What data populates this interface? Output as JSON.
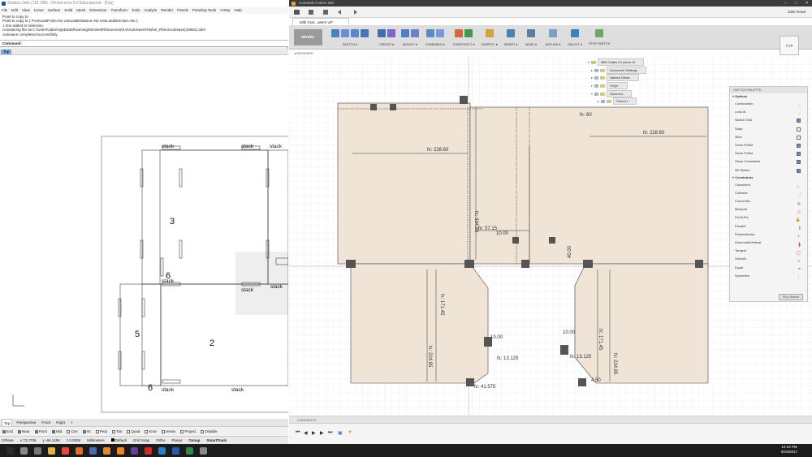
{
  "rhino": {
    "title": "Slotbox.3dm (191 MB) - Rhinoceros 5.0 Educational - [Top]",
    "menu": [
      "File",
      "Edit",
      "View",
      "Curve",
      "Surface",
      "Solid",
      "Mesh",
      "Dimension",
      "Transform",
      "Tools",
      "Analyze",
      "Render",
      "Panels",
      "Paneling Tools",
      "V-Ray",
      "Help"
    ],
    "command_history": [
      "Point to copy to",
      "Point to copy to ( FromLastPoint=No  UseLastDistance=No  UseLastDirection=No ):",
      "1 text added to selection.",
      "Autosaving file as C:\\Users\\Jake\\AppData\\Roaming\\McNeel\\Rhinoceros\\5.0\\AutoSave\\rhtshot_RhinoAutosave(15664).3dm",
      "Autosave completed successfully"
    ],
    "command_label": "Command:",
    "viewport_label": "Top",
    "drawing": {
      "labels": [
        "stack",
        "stack",
        "stack",
        "stack",
        "stack",
        "stack",
        "stack",
        "stack"
      ],
      "numbers": [
        "3",
        "6",
        "5",
        "2",
        "6"
      ]
    },
    "viewport_tabs": [
      "Top",
      "Perspective",
      "Front",
      "Right",
      "+"
    ],
    "osnaps": [
      {
        "label": "End",
        "on": true
      },
      {
        "label": "Near",
        "on": true
      },
      {
        "label": "Point",
        "on": true
      },
      {
        "label": "Mid",
        "on": true
      },
      {
        "label": "Cen",
        "on": false
      },
      {
        "label": "Int",
        "on": true
      },
      {
        "label": "Perp",
        "on": false
      },
      {
        "label": "Tan",
        "on": false
      },
      {
        "label": "Quad",
        "on": false
      },
      {
        "label": "Knot",
        "on": false
      },
      {
        "label": "Vertex",
        "on": false
      },
      {
        "label": "Project",
        "on": false
      },
      {
        "label": "Disable",
        "on": false
      }
    ],
    "status": {
      "cplane": "CPlane",
      "x": "x 73.2706",
      "y": "y -66.1456",
      "z": "z 0.0000",
      "units": "Millimeters",
      "layer": "Default",
      "grid_snap": "Grid Snap",
      "ortho": "Ortho",
      "planar": "Planar",
      "osnap": "Osnap",
      "smarttrack": "SmartTrack"
    }
  },
  "fusion": {
    "title": "Autodesk Fusion 360",
    "user": "Jake Read",
    "doc_tab": "Milk Crat...asers v3*",
    "workspace": "MODEL",
    "ribbon_groups": [
      {
        "label": "SKETCH ▾",
        "colors": [
          "#4a7fc1",
          "#6b8fd6",
          "#5c87c9",
          "#4a74b8"
        ]
      },
      {
        "label": "CREATE ▾",
        "colors": [
          "#3d6fb5",
          "#7b68c8"
        ]
      },
      {
        "label": "MODIFY ▾",
        "colors": [
          "#4e7fc5",
          "#6f7fd0"
        ]
      },
      {
        "label": "ASSEMBLE ▾",
        "colors": [
          "#5b8ac9",
          "#7a9bd8"
        ]
      },
      {
        "label": "CONSTRUCT ▾",
        "colors": [
          "#d06a3a",
          "#3e9a4e"
        ]
      },
      {
        "label": "INSPECT ▾",
        "colors": [
          "#d0a33c"
        ]
      },
      {
        "label": "INSERT ▾",
        "colors": [
          "#4f7fb0"
        ]
      },
      {
        "label": "MAKE ▾",
        "colors": [
          "#5e7e9e"
        ]
      },
      {
        "label": "ADD-INS ▾",
        "colors": [
          "#7aa0c8"
        ]
      },
      {
        "label": "SELECT ▾",
        "colors": [
          "#3e7fc4"
        ]
      },
      {
        "label": "STOP SKETCH",
        "colors": [
          "#6aa86a"
        ]
      }
    ],
    "browser_label": "BROWSER",
    "tree": [
      "Milk Crates & Lasers v3",
      "Document Settings",
      "Named Views",
      "Origin",
      "Sketches",
      "Sketch1"
    ],
    "viewcube": "TOP",
    "dimensions": [
      "fx: 228.60",
      "fx: 228.60",
      "fx: 60",
      "fx: 334.80",
      "fx: 57.15",
      "10.00",
      "40.00",
      "fx: 171.45",
      "fx: 171.45",
      "fx: 224.85",
      "fx: 224.85",
      "10.00",
      "10.00",
      "fx: 13.125",
      "fx: 13.125",
      "fx: 41.575",
      "4.50"
    ],
    "sketch_palette": {
      "title": "SKETCH PALETTE",
      "options_label": "Options",
      "options": [
        {
          "label": "Construction",
          "kind": "icon"
        },
        {
          "label": "Look At",
          "kind": "icon"
        },
        {
          "label": "Sketch Grid",
          "kind": "check",
          "on": true
        },
        {
          "label": "Snap",
          "kind": "check",
          "on": false
        },
        {
          "label": "Slice",
          "kind": "check",
          "on": false
        },
        {
          "label": "Show Profile",
          "kind": "check",
          "on": true
        },
        {
          "label": "Show Points",
          "kind": "check",
          "on": true
        },
        {
          "label": "Show Constraints",
          "kind": "check",
          "on": true
        },
        {
          "label": "3D Sketch",
          "kind": "check",
          "on": true
        }
      ],
      "constraints_label": "Constraints",
      "constraints": [
        "Coincident",
        "Collinear",
        "Concentric",
        "Midpoint",
        "Fix/UnFix",
        "Parallel",
        "Perpendicular",
        "Horizontal/Vertical",
        "Tangent",
        "Smooth",
        "Equal",
        "Symmetry"
      ],
      "stop_button": "Stop Sketch"
    },
    "comments_label": "COMMENTS"
  },
  "taskbar": {
    "icons": [
      {
        "name": "start",
        "color": "#2b2b2b"
      },
      {
        "name": "search",
        "color": "#888888"
      },
      {
        "name": "task-view",
        "color": "#777777"
      },
      {
        "name": "explorer",
        "color": "#e8b23a"
      },
      {
        "name": "chrome",
        "color": "#e04a3a"
      },
      {
        "name": "firefox",
        "color": "#e86a2a"
      },
      {
        "name": "rhino",
        "color": "#4a6ab0"
      },
      {
        "name": "fusion",
        "color": "#e08a2a"
      },
      {
        "name": "illustrator",
        "color": "#e8862a"
      },
      {
        "name": "premiere",
        "color": "#6a3aa0"
      },
      {
        "name": "acrobat",
        "color": "#c8302a"
      },
      {
        "name": "photoshop",
        "color": "#2a80c8"
      },
      {
        "name": "word",
        "color": "#2a5aa8"
      },
      {
        "name": "excel",
        "color": "#2a8a4a"
      },
      {
        "name": "app",
        "color": "#888888"
      }
    ],
    "time": "12:19 PM",
    "date": "9/19/2017"
  }
}
